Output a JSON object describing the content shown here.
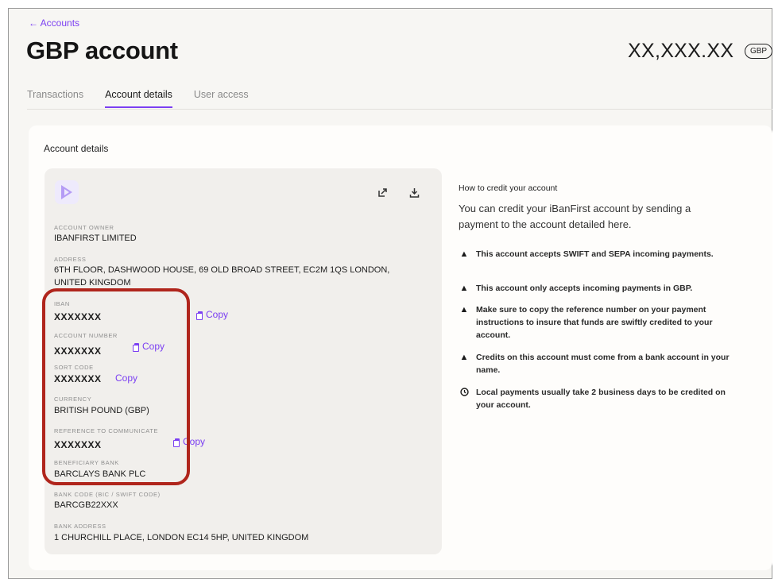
{
  "nav": {
    "back_label": "← Accounts"
  },
  "header": {
    "title": "GBP account",
    "balance": "XX,XXX.XX",
    "currency": "GBP"
  },
  "tabs": [
    {
      "label": "Transactions",
      "active": false
    },
    {
      "label": "Account details",
      "active": true
    },
    {
      "label": "User access",
      "active": false
    }
  ],
  "card": {
    "title": "Account details"
  },
  "details": {
    "account_owner": {
      "label": "ACCOUNT OWNER",
      "value": "IBANFIRST LIMITED"
    },
    "address": {
      "label": "ADDRESS",
      "value": "6TH FLOOR, DASHWOOD HOUSE, 69 OLD BROAD STREET, EC2M 1QS LONDON, UNITED KINGDOM"
    },
    "iban": {
      "label": "IBAN",
      "value": "XXXXXXX",
      "copy": "Copy"
    },
    "account_number": {
      "label": "ACCOUNT NUMBER",
      "value": "XXXXXXX",
      "copy": "Copy"
    },
    "sort_code": {
      "label": "SORT CODE",
      "value": "XXXXXXX",
      "copy": "Copy"
    },
    "currency": {
      "label": "CURRENCY",
      "value": "BRITISH POUND (GBP)"
    },
    "reference": {
      "label": "REFERENCE TO COMMUNICATE",
      "value": "XXXXXXX",
      "copy": "Copy"
    },
    "beneficiary_bank": {
      "label": "BENEFICIARY BANK",
      "value": "BARCLAYS BANK PLC"
    },
    "bank_code": {
      "label": "BANK CODE (BIC / SWIFT CODE)",
      "value": "BARCGB22XXX"
    },
    "bank_address": {
      "label": "BANK ADDRESS",
      "value": "1 CHURCHILL PLACE, LONDON EC14 5HP, UNITED KINGDOM"
    }
  },
  "howto": {
    "title": "How to credit your account",
    "intro": "You can credit your iBanFirst account by sending a payment to the account detailed here.",
    "items": [
      {
        "icon": "warning-icon",
        "text": "This account accepts SWIFT and SEPA incoming payments."
      },
      {
        "icon": "warning-icon",
        "text": "This account only accepts incoming payments in GBP."
      },
      {
        "icon": "warning-icon",
        "text": "Make sure to copy the reference number on your payment instructions to insure that funds are swiftly credited to your account."
      },
      {
        "icon": "warning-icon",
        "text": "Credits on this account must come from a bank account in your name."
      },
      {
        "icon": "clock-icon",
        "text": "Local payments usually take 2 business days to be credited on your account."
      }
    ]
  },
  "colors": {
    "accent": "#7b3ff2",
    "highlight": "#b0251c"
  }
}
